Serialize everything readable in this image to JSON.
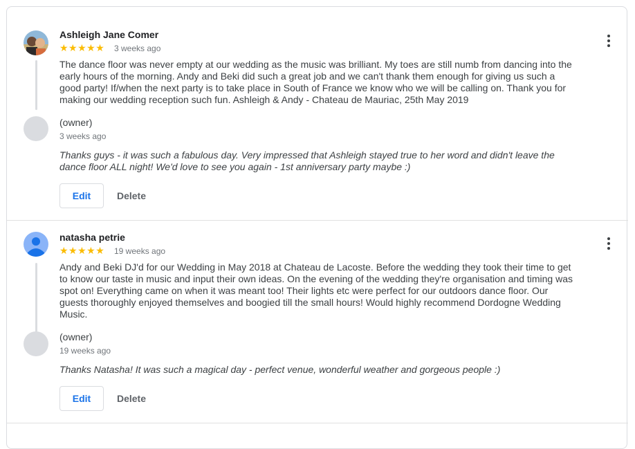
{
  "reviews": [
    {
      "author": "Ashleigh Jane Comer",
      "stars": "★★★★★",
      "date": "3 weeks ago",
      "text": "The dance floor was never empty at our wedding as the music was brilliant. My toes are still numb from dancing into the early hours of the morning. Andy and Beki did such a great job and we can't thank them enough for giving us such a good party! If/when the next party is to take place in South of France we know who we will be calling on. Thank you for making our wedding reception such fun. Ashleigh & Andy - Chateau de Mauriac, 25th May 2019",
      "owner_label": "(owner)",
      "owner_date": "3 weeks ago",
      "reply": "Thanks guys - it was such a fabulous day. Very impressed that Ashleigh stayed true to her word and didn't leave the dance floor ALL night! We'd love to see you again - 1st anniversary party maybe :)",
      "edit_label": "Edit",
      "delete_label": "Delete"
    },
    {
      "author": "natasha petrie",
      "stars": "★★★★★",
      "date": "19 weeks ago",
      "text": "Andy and Beki DJ'd for our Wedding in May 2018 at Chateau de Lacoste. Before the wedding they took their time to get to know our taste in music and input their own ideas. On the evening of the wedding they're organisation and timing was spot on! Everything came on when it was meant too! Their lights etc were perfect for our outdoors dance floor. Our guests thoroughly enjoyed themselves and boogied till the small hours! Would highly recommend Dordogne Wedding Music.",
      "owner_label": "(owner)",
      "owner_date": "19 weeks ago",
      "reply": "Thanks Natasha! It was such a magical day - perfect venue, wonderful weather and gorgeous people :)",
      "edit_label": "Edit",
      "delete_label": "Delete"
    }
  ],
  "colors": {
    "star": "#fbbc04",
    "accent": "#1a73e8",
    "default_avatar": "#8ab4f8"
  },
  "icons": {
    "more": "more-vert-icon",
    "photo_avatar": "user-photo-icon",
    "default_avatar": "person-icon"
  }
}
